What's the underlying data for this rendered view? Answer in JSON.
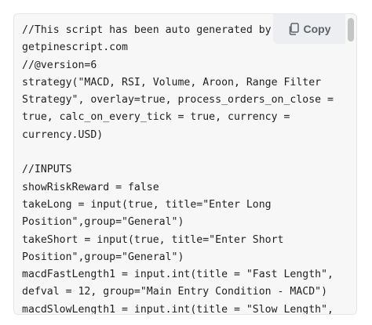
{
  "code_block": {
    "lines": [
      "//This script has been auto generated by",
      "getpinescript.com",
      "//@version=6",
      "strategy(\"MACD, RSI, Volume, Aroon, Range Filter",
      "Strategy\", overlay=true, process_orders_on_close =",
      "true, calc_on_every_tick = true, currency =",
      "currency.USD)",
      "",
      "//INPUTS",
      "showRiskReward = false",
      "takeLong = input(true, title=\"Enter Long",
      "Position\",group=\"General\")",
      "takeShort = input(true, title=\"Enter Short",
      "Position\",group=\"General\")",
      "macdFastLength1 = input.int(title = \"Fast Length\",",
      "defval = 12, group=\"Main Entry Condition - MACD\")",
      "macdSlowLength1 = input.int(title = \"Slow Length\","
    ]
  },
  "copy_button": {
    "label": "Copy",
    "icon": "copy-icon"
  }
}
